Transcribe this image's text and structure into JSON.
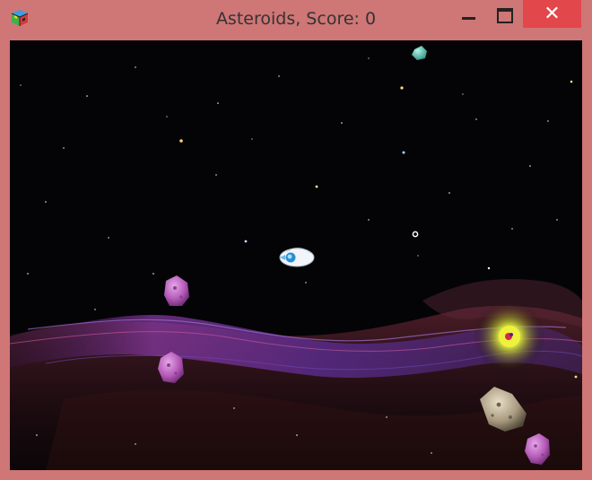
{
  "window": {
    "title": "Asteroids, Score: 0",
    "controls": {
      "minimize": "minimize",
      "maximize": "maximize",
      "close": "✕"
    },
    "frame_color": "#cf7676",
    "close_color": "#e2474b"
  },
  "game": {
    "background": "starfield-nebula",
    "sprites": [
      "player-ship",
      "asteroid",
      "powerup-glow",
      "reticle"
    ]
  }
}
